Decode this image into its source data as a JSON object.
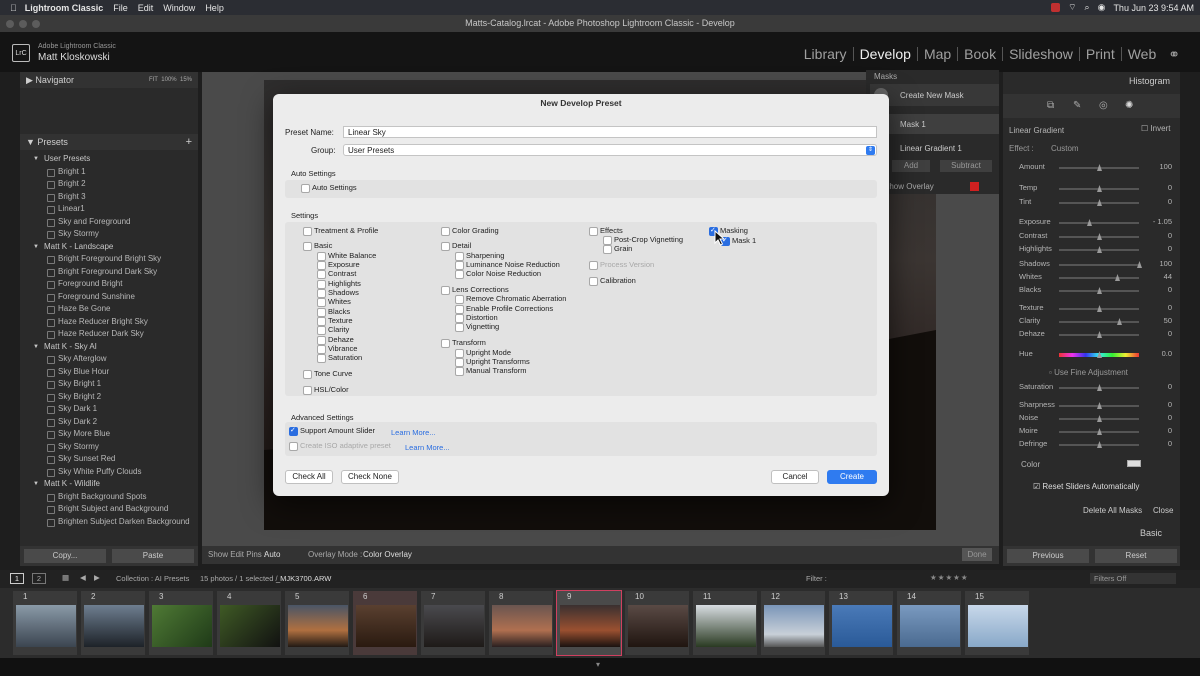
{
  "menubar": {
    "app": "Lightroom Classic",
    "items": [
      "File",
      "Edit",
      "Window",
      "Help"
    ],
    "datetime": "Thu Jun 23  9:54 AM"
  },
  "window": {
    "title": "Matts-Catalog.lrcat - Adobe Photoshop Lightroom Classic - Develop"
  },
  "identity": {
    "brand": "Adobe Lightroom Classic",
    "user": "Matt Kloskowski",
    "logo": "LrC"
  },
  "modules": [
    "Library",
    "Develop",
    "Map",
    "Book",
    "Slideshow",
    "Print",
    "Web"
  ],
  "left": {
    "navigator": {
      "title": "Navigator",
      "zoom": [
        "FIT",
        "100%",
        "15%"
      ]
    },
    "presets": {
      "title": "Presets",
      "groups": [
        {
          "name": "User Presets",
          "items": [
            "Bright 1",
            "Bright 2",
            "Bright 3",
            "Linear1",
            "Sky and Foreground",
            "Sky Stormy"
          ]
        },
        {
          "name": "Matt K - Landscape",
          "items": [
            "Bright Foreground Bright Sky",
            "Bright Foreground Dark Sky",
            "Foreground Bright",
            "Foreground Sunshine",
            "Haze Be Gone",
            "Haze Reducer Bright Sky",
            "Haze Reducer Dark Sky"
          ]
        },
        {
          "name": "Matt K - Sky AI",
          "items": [
            "Sky Afterglow",
            "Sky Blue Hour",
            "Sky Bright 1",
            "Sky Bright 2",
            "Sky Dark 1",
            "Sky Dark 2",
            "Sky More Blue",
            "Sky Stormy",
            "Sky Sunset Red",
            "Sky White Puffy Clouds"
          ]
        },
        {
          "name": "Matt K - Wildlife",
          "items": [
            "Bright Background Spots",
            "Bright Subject and Background",
            "Brighten Subject Darken Background"
          ]
        }
      ]
    },
    "copy": "Copy...",
    "paste": "Paste"
  },
  "toolbar": {
    "edit_pins_label": "Show Edit Pins :",
    "edit_pins_value": "Auto",
    "overlay_label": "Overlay Mode :",
    "overlay_value": "Color Overlay",
    "done": "Done"
  },
  "masks": {
    "title": "Masks",
    "create": "Create New Mask",
    "mask1": "Mask 1",
    "linear": "Linear Gradient 1",
    "add": "Add",
    "subtract": "Subtract",
    "overlay": "Show Overlay"
  },
  "right": {
    "histogram": "Histogram",
    "mask_type": "Linear Gradient",
    "invert": "Invert",
    "effect_label": "Effect :",
    "effect_value": "Custom",
    "sliders": [
      {
        "name": "Amount",
        "value": "100",
        "pos": 0.5
      },
      {
        "name": "Temp",
        "value": "0",
        "pos": 0.5
      },
      {
        "name": "Tint",
        "value": "0",
        "pos": 0.5
      },
      {
        "name": "Exposure",
        "value": "- 1.05",
        "pos": 0.37
      },
      {
        "name": "Contrast",
        "value": "0",
        "pos": 0.5
      },
      {
        "name": "Highlights",
        "value": "0",
        "pos": 0.5
      },
      {
        "name": "Shadows",
        "value": "100",
        "pos": 1.0
      },
      {
        "name": "Whites",
        "value": "44",
        "pos": 0.72
      },
      {
        "name": "Blacks",
        "value": "0",
        "pos": 0.5
      },
      {
        "name": "Texture",
        "value": "0",
        "pos": 0.5
      },
      {
        "name": "Clarity",
        "value": "50",
        "pos": 0.75
      },
      {
        "name": "Dehaze",
        "value": "0",
        "pos": 0.5
      },
      {
        "name": "Hue",
        "value": "0.0",
        "pos": 0.5
      },
      {
        "name": "Saturation",
        "value": "0",
        "pos": 0.5
      },
      {
        "name": "Sharpness",
        "value": "0",
        "pos": 0.5
      },
      {
        "name": "Noise",
        "value": "0",
        "pos": 0.5
      },
      {
        "name": "Moire",
        "value": "0",
        "pos": 0.5
      },
      {
        "name": "Defringe",
        "value": "0",
        "pos": 0.5
      }
    ],
    "fine_adjust": "Use Fine Adjustment",
    "color": "Color",
    "reset_sliders": "Reset Sliders Automatically",
    "delete_all": "Delete All Masks",
    "close": "Close",
    "basic": "Basic",
    "previous": "Previous",
    "reset": "Reset"
  },
  "dialog": {
    "title": "New Develop Preset",
    "preset_name_label": "Preset Name:",
    "preset_name": "Linear Sky",
    "group_label": "Group:",
    "group_value": "User Presets",
    "auto_settings_header": "Auto Settings",
    "auto_settings": "Auto Settings",
    "settings_header": "Settings",
    "col1": [
      "Treatment & Profile",
      "Basic",
      "White Balance",
      "Exposure",
      "Contrast",
      "Highlights",
      "Shadows",
      "Whites",
      "Blacks",
      "Texture",
      "Clarity",
      "Dehaze",
      "Vibrance",
      "Saturation",
      "Tone Curve",
      "HSL/Color"
    ],
    "col2": [
      "Color Grading",
      "Detail",
      "Sharpening",
      "Luminance Noise Reduction",
      "Color Noise Reduction",
      "Lens Corrections",
      "Remove Chromatic Aberration",
      "Enable Profile Corrections",
      "Distortion",
      "Vignetting",
      "Transform",
      "Upright Mode",
      "Upright Transforms",
      "Manual Transform"
    ],
    "col3": [
      "Effects",
      "Post-Crop Vignetting",
      "Grain",
      "Process Version",
      "Calibration"
    ],
    "col4": [
      "Masking",
      "Mask 1"
    ],
    "advanced_header": "Advanced Settings",
    "support_amount": "Support Amount Slider",
    "learn_more": "Learn More...",
    "iso_adaptive": "Create ISO adaptive preset",
    "check_all": "Check All",
    "check_none": "Check None",
    "cancel": "Cancel",
    "create": "Create"
  },
  "filmstrip": {
    "collection": "Collection : AI Presets",
    "count": "15 photos / 1 selected /",
    "file": "_MJK3700.ARW",
    "filter_label": "Filter :",
    "filters_off": "Filters Off",
    "pages": [
      "1",
      "2"
    ],
    "thumbs": [
      "1",
      "2",
      "3",
      "4",
      "5",
      "6",
      "7",
      "8",
      "9",
      "10",
      "11",
      "12",
      "13",
      "14",
      "15"
    ]
  }
}
